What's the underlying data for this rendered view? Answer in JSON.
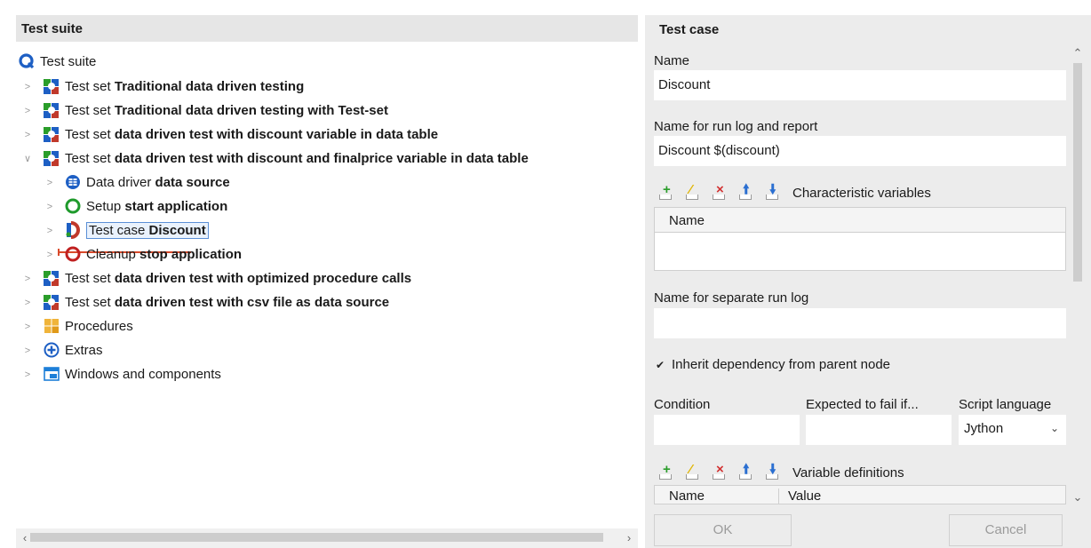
{
  "tree": {
    "header": "Test suite",
    "rows": [
      {
        "prefix": "Test suite",
        "bold": ""
      },
      {
        "prefix": "Test set ",
        "bold": "Traditional data driven testing"
      },
      {
        "prefix": "Test set ",
        "bold": "Traditional data driven testing with Test-set"
      },
      {
        "prefix": "Test set ",
        "bold": "data driven test with discount variable in data table"
      },
      {
        "prefix": "Test set ",
        "bold": "data driven test with discount and finalprice variable in data table"
      },
      {
        "prefix": "Data driver ",
        "bold": "data source"
      },
      {
        "prefix": "Setup ",
        "bold": "start application"
      },
      {
        "prefix": "Test case ",
        "bold": "Discount"
      },
      {
        "prefix": "Cleanup ",
        "bold": "stop application"
      },
      {
        "prefix": "Test set ",
        "bold": "data driven test with optimized procedure calls"
      },
      {
        "prefix": "Test set ",
        "bold": "data driven test with csv file as data source"
      },
      {
        "prefix": "Procedures",
        "bold": ""
      },
      {
        "prefix": "Extras",
        "bold": ""
      },
      {
        "prefix": "Windows and components",
        "bold": ""
      }
    ]
  },
  "detail": {
    "header": "Test case",
    "name_label": "Name",
    "name_value": "Discount",
    "runlog_label": "Name for run log and report",
    "runlog_value": "Discount $(discount)",
    "char_vars_label": "Characteristic variables",
    "char_vars_col": "Name",
    "sep_runlog_label": "Name for separate run log",
    "sep_runlog_value": "",
    "inherit_label": "Inherit dependency from parent node",
    "inherit_checked": true,
    "condition_label": "Condition",
    "condition_value": "",
    "expected_label": "Expected to fail if...",
    "expected_value": "",
    "script_lang_label": "Script language",
    "script_lang_value": "Jython",
    "var_defs_label": "Variable definitions",
    "var_defs_cols": [
      "Name",
      "Value"
    ],
    "ok_label": "OK",
    "cancel_label": "Cancel"
  },
  "colors": {
    "add": "#2a9d2a",
    "edit": "#e0b400",
    "delete": "#d23030",
    "move": "#2b6fd1",
    "setup": "#1f9a2c",
    "cleanup": "#c02020"
  }
}
